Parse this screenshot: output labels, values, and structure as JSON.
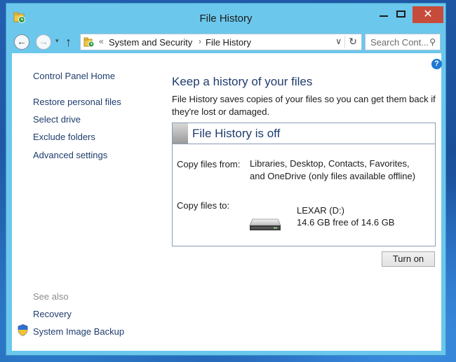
{
  "window": {
    "title": "File History",
    "close_glyph": "✕"
  },
  "address_bar": {
    "back_glyph": "←",
    "forward_glyph": "→",
    "recent_glyph": "▾",
    "up_glyph": "↑",
    "separator_glyph": "«",
    "breadcrumb": [
      "System and Security",
      "File History"
    ],
    "crumb_separator_glyph": "›",
    "dropdown_glyph": "∨",
    "refresh_glyph": "↻",
    "search_placeholder": "Search Cont...",
    "search_glyph": "⚲"
  },
  "sidebar": {
    "home_link": "Control Panel Home",
    "links": [
      "Restore personal files",
      "Select drive",
      "Exclude folders",
      "Advanced settings"
    ],
    "see_also_label": "See also",
    "see_also_links": [
      "Recovery",
      "System Image Backup"
    ]
  },
  "main": {
    "heading": "Keep a history of your files",
    "description": "File History saves copies of your files so you can get them back if they're lost or damaged.",
    "status_title": "File History is off",
    "copy_from_label": "Copy files from:",
    "copy_from_value": "Libraries, Desktop, Contacts, Favorites, and OneDrive (only files available offline)",
    "copy_to_label": "Copy files to:",
    "drive_name": "LEXAR (D:)",
    "drive_space": "14.6 GB free of 14.6 GB",
    "turn_on_label": "Turn on",
    "help_glyph": "?"
  },
  "icons": {
    "window_icon": "file-history-icon",
    "help": "help-icon",
    "shield": "uac-shield-icon",
    "drive": "removable-drive-icon"
  },
  "colors": {
    "window_frame": "#6cc7ec",
    "close_button": "#c74b3a",
    "link": "#1f3c6d",
    "panel_border": "#8a9bb5"
  }
}
